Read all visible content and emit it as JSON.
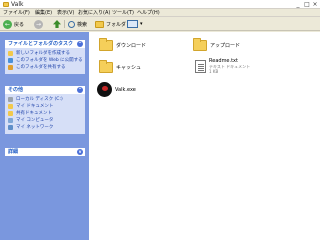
{
  "window": {
    "title": "Valk"
  },
  "window_controls": {
    "minimize": "_",
    "maximize": "□",
    "close": "×"
  },
  "menu": [
    "ファイル(F)",
    "編集(E)",
    "表示(V)",
    "お気に入り(A)",
    "ツール(T)",
    "ヘルプ(H)"
  ],
  "toolbar": {
    "back": "戻る",
    "search": "検索",
    "folders": "フォルダ"
  },
  "tasks_panel": {
    "title": "ファイルとフォルダのタスク",
    "items": [
      "新しいフォルダを作成する",
      "このフォルダを Web に公開する",
      "このフォルダを共有する"
    ]
  },
  "places_panel": {
    "title": "その他",
    "items": [
      "ローカル ディスク (C:)",
      "マイ ドキュメント",
      "共有ドキュメント",
      "マイ コンピュータ",
      "マイ ネットワーク"
    ]
  },
  "details_panel": {
    "title": "詳細"
  },
  "files": [
    {
      "name": "ダウンロード",
      "kind": "folder"
    },
    {
      "name": "アップロード",
      "kind": "folder"
    },
    {
      "name": "キャッシュ",
      "kind": "folder"
    },
    {
      "name": "Readme.txt",
      "kind": "text",
      "type": "テキスト ドキュメント",
      "size": "1 KB"
    },
    {
      "name": "Valk.exe",
      "kind": "exe"
    }
  ]
}
